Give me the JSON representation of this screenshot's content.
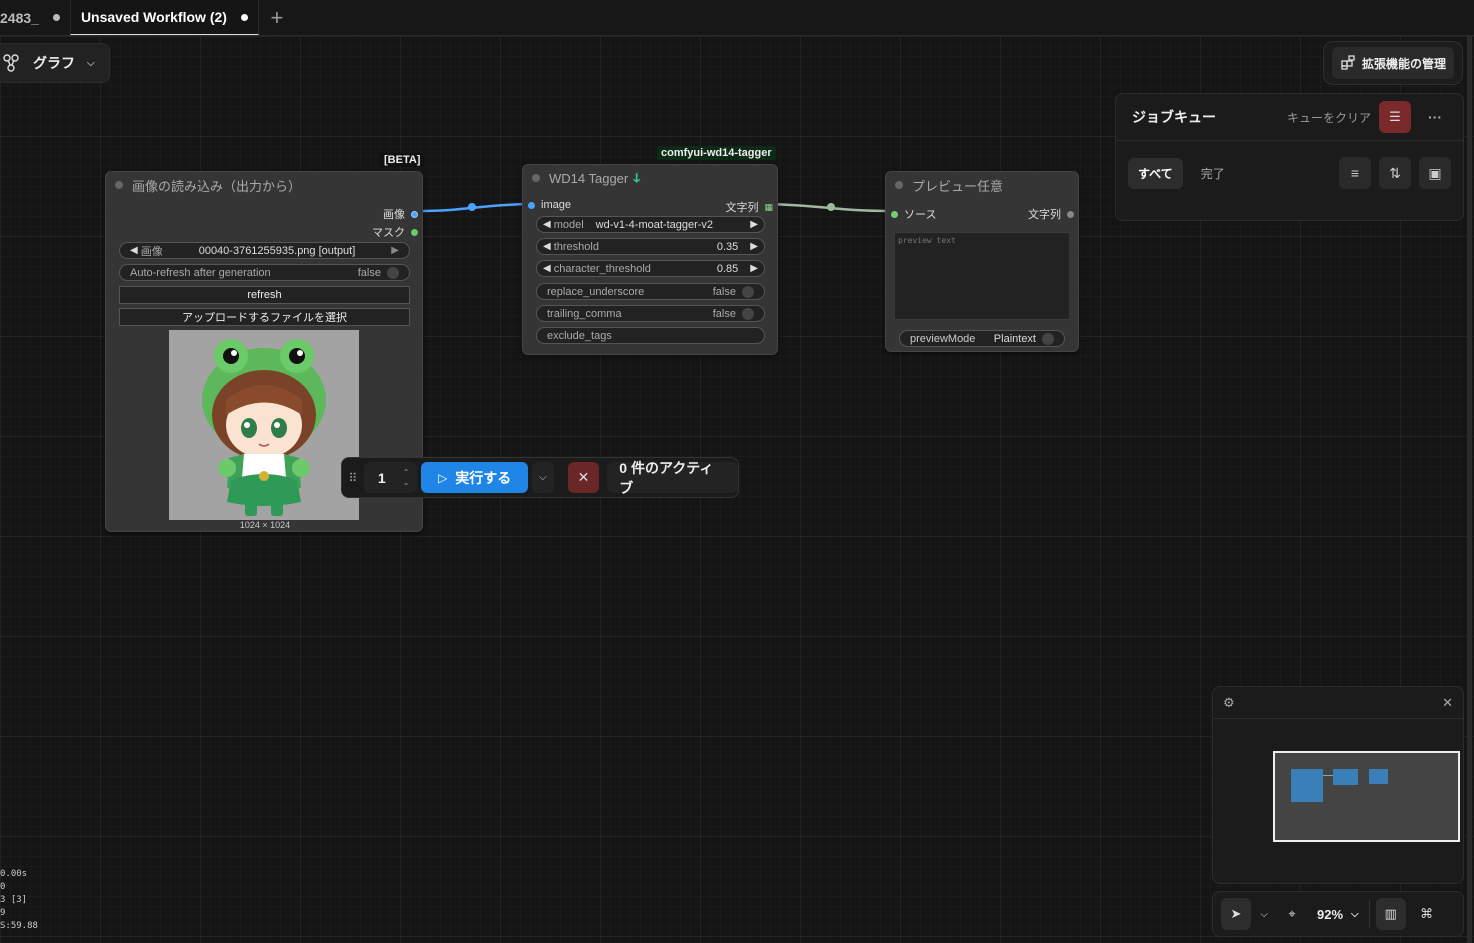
{
  "tabs": [
    {
      "label": "2483_",
      "modified": true
    },
    {
      "label": "Unsaved Workflow (2)",
      "modified": true
    }
  ],
  "graph_button": {
    "label": "グラフ"
  },
  "extensions_button": {
    "label": "拡張機能の管理"
  },
  "job_queue": {
    "title": "ジョブキュー",
    "clear_label": "キューをクリア",
    "filters": [
      "すべて",
      "完了"
    ]
  },
  "nodes": {
    "load_image": {
      "title": "画像の読み込み（出力から）",
      "badge": "[BETA]",
      "outputs": [
        "画像",
        "マスク"
      ],
      "image_widget": {
        "label": "画像",
        "value": "00040-3761255935.png [output]"
      },
      "auto_refresh": {
        "label": "Auto-refresh after generation",
        "value": "false"
      },
      "refresh_label": "refresh",
      "upload_label": "アップロードするファイルを選択",
      "image_size": "1024 × 1024"
    },
    "tagger": {
      "title": "WD14 Tagger",
      "badge": "comfyui-wd14-tagger",
      "input": "image",
      "output": "文字列",
      "widgets": [
        {
          "label": "model",
          "value": "wd-v1-4-moat-tagger-v2"
        },
        {
          "label": "threshold",
          "value": "0.35"
        },
        {
          "label": "character_threshold",
          "value": "0.85"
        },
        {
          "label": "replace_underscore",
          "value": "false"
        },
        {
          "label": "trailing_comma",
          "value": "false"
        },
        {
          "label": "exclude_tags",
          "value": ""
        }
      ]
    },
    "preview": {
      "title": "プレビュー任意",
      "input": "ソース",
      "output": "文字列",
      "textarea_placeholder": "preview text",
      "mode_label": "previewMode",
      "mode_value": "Plaintext"
    }
  },
  "run_bar": {
    "count": "1",
    "run_label": "実行する",
    "active_label": "0 件のアクティブ"
  },
  "canvas": {
    "zoom": "92%"
  },
  "stats": [
    "0.00s",
    "0",
    "3 [3]",
    "9",
    "S:59.88"
  ],
  "colors": {
    "accent": "#1f86e8",
    "danger": "#7a2a2a",
    "image_link": "#4aa3ff",
    "string_link": "#a0b8a0"
  }
}
